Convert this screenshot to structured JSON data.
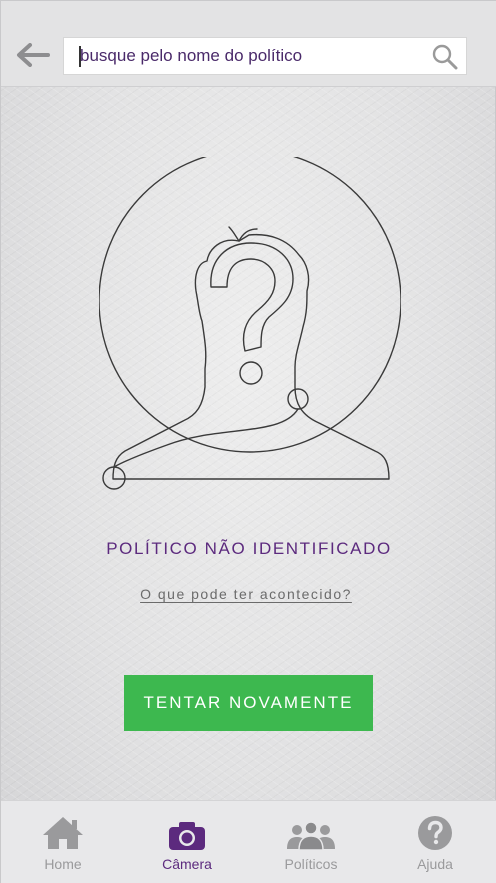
{
  "search": {
    "placeholder": "busque pelo nome do político"
  },
  "icons": {
    "back": "arrow-left-icon",
    "search": "search-icon",
    "illustration": "unknown-person-question-icon",
    "home": "home-icon",
    "camera": "camera-icon",
    "politicians": "people-group-icon",
    "help": "help-question-icon"
  },
  "main": {
    "status_title": "POLÍTICO NÃO IDENTIFICADO",
    "help_link": "O que pode ter acontecido?",
    "retry_button": "TENTAR NOVAMENTE"
  },
  "nav": {
    "items": [
      {
        "label": "Home",
        "active": false
      },
      {
        "label": "Câmera",
        "active": true
      },
      {
        "label": "Políticos",
        "active": false
      },
      {
        "label": "Ajuda",
        "active": false
      }
    ]
  },
  "colors": {
    "accent": "#5c2a7e",
    "button": "#3db84f",
    "inactive": "#9a9a9c"
  }
}
